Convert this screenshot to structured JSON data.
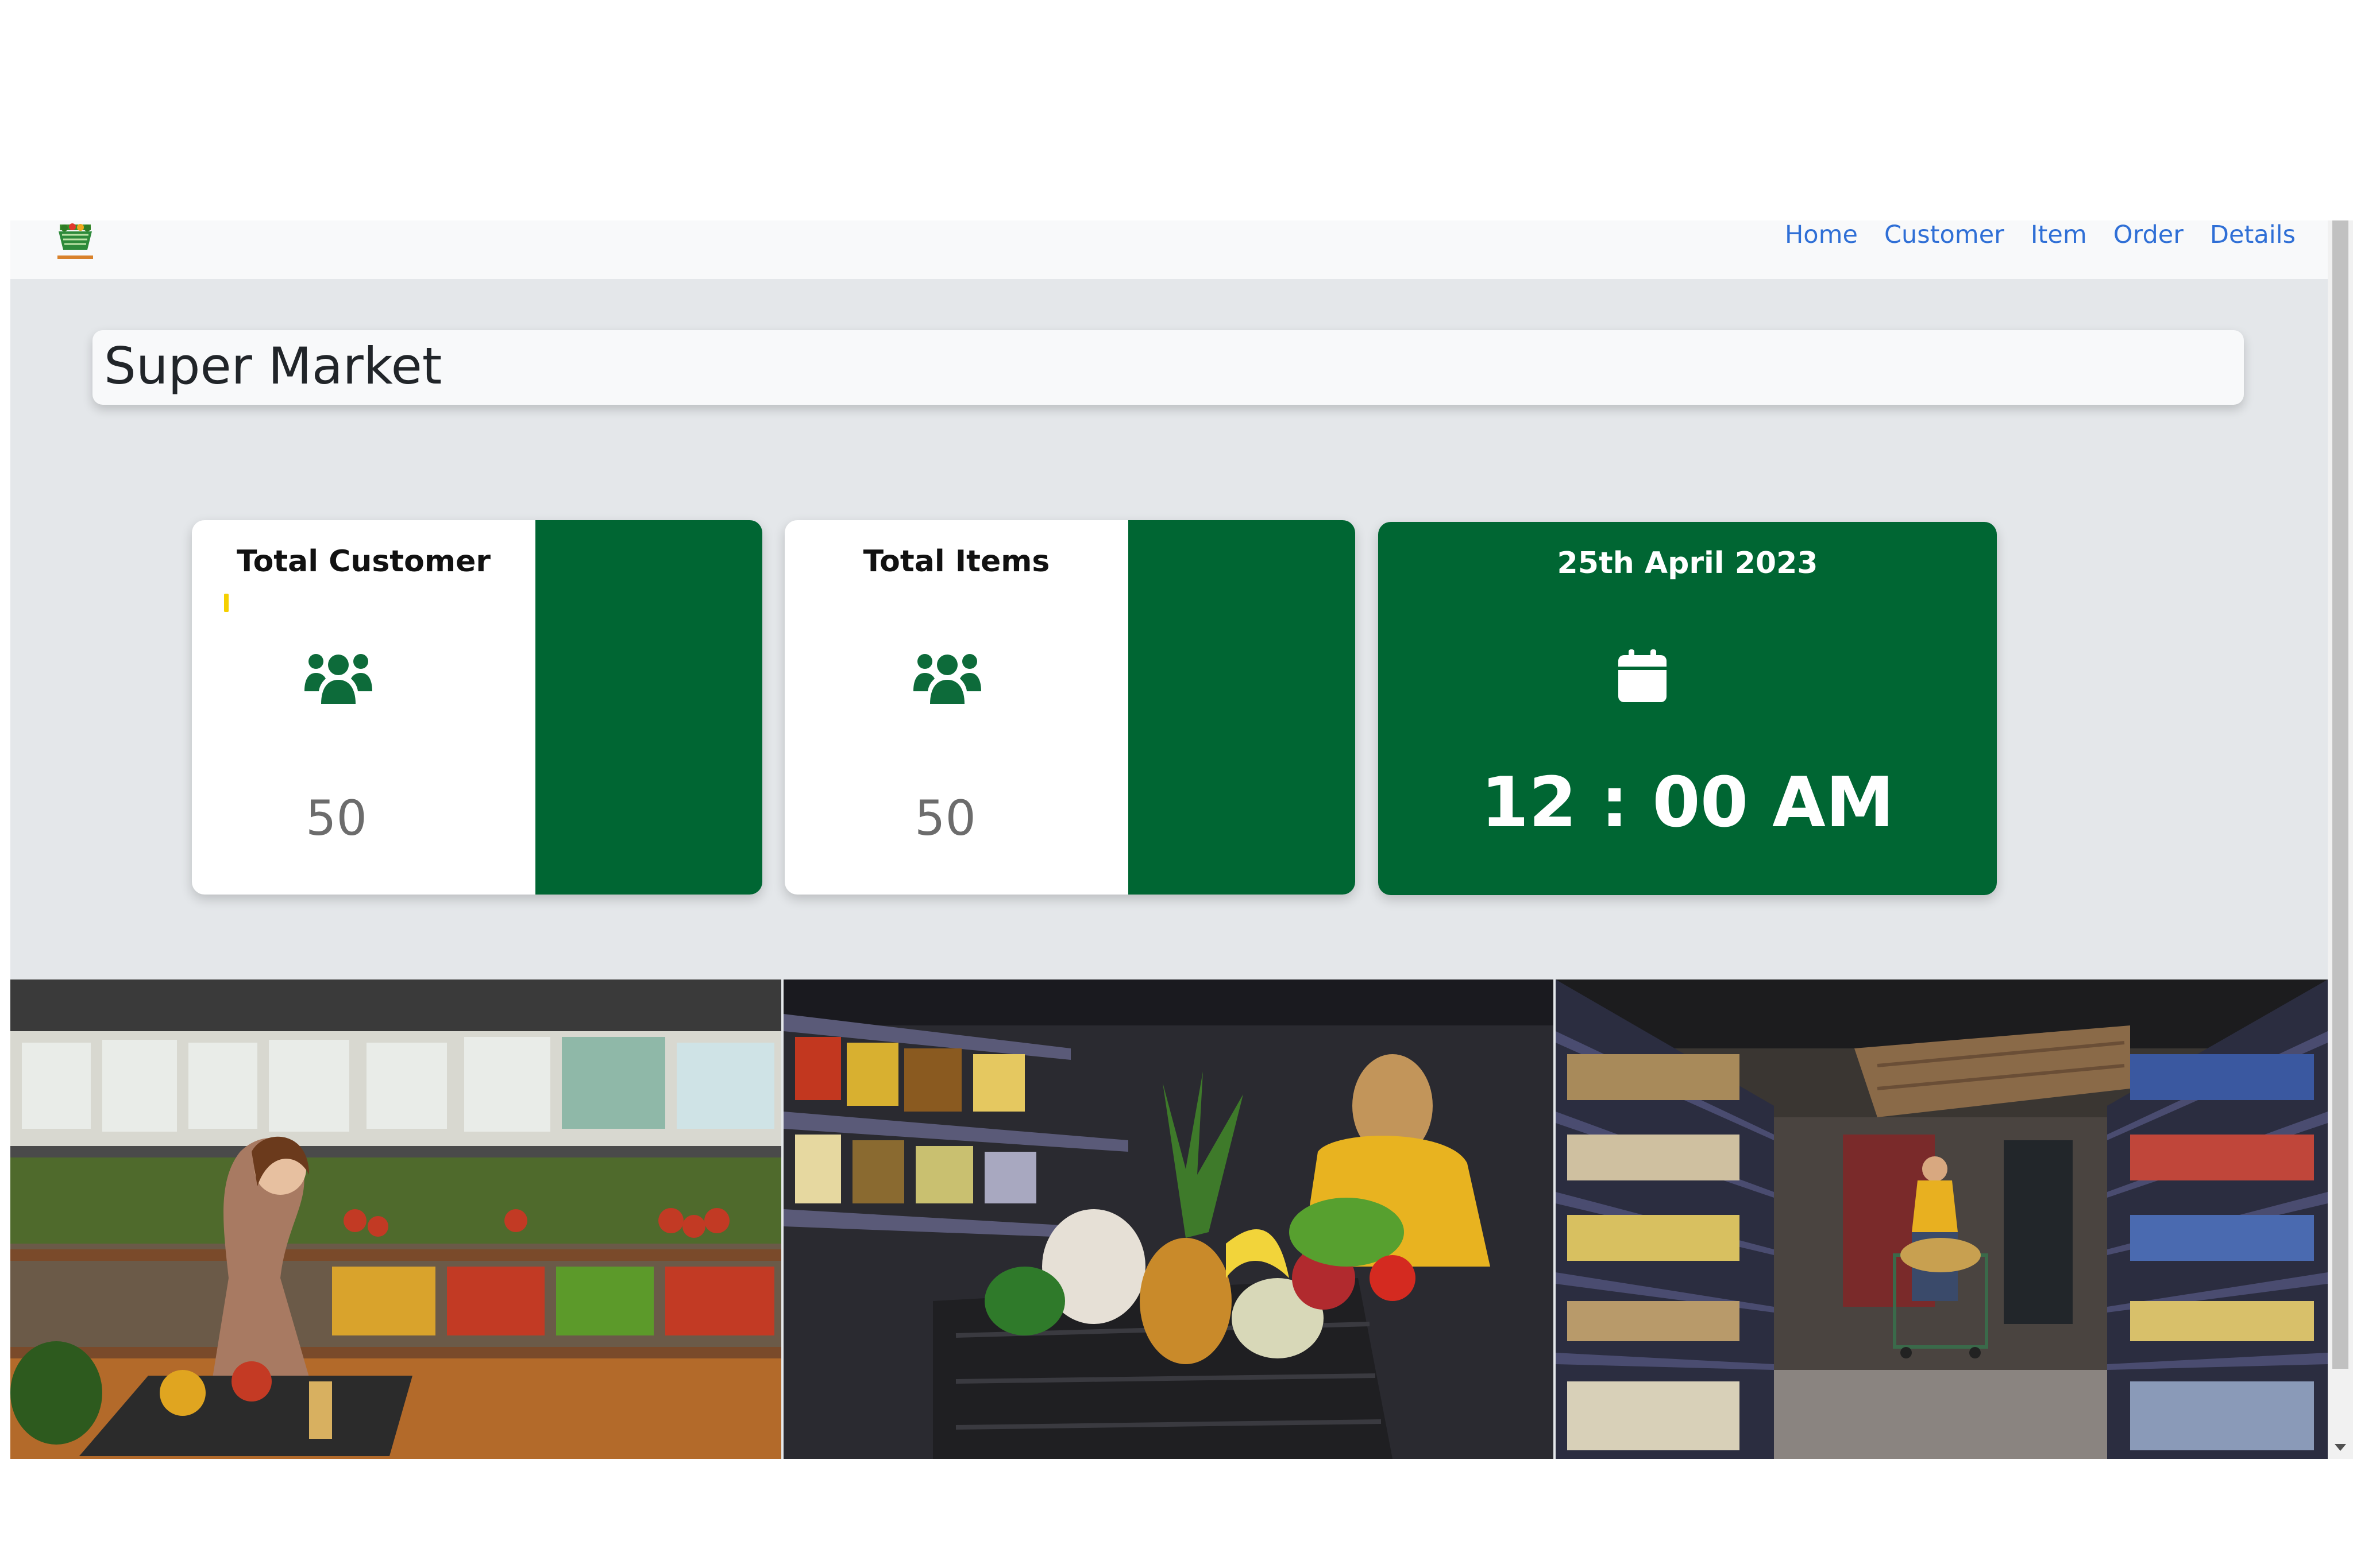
{
  "navbar": {
    "logo_icon": "supermarket-basket-logo",
    "links": [
      {
        "label": "Home"
      },
      {
        "label": "Customer"
      },
      {
        "label": "Item"
      },
      {
        "label": "Order"
      },
      {
        "label": "Details"
      }
    ]
  },
  "header": {
    "title": "Super Market"
  },
  "cards": {
    "customer": {
      "title": "Total Customer",
      "value": "50",
      "icon": "users-icon"
    },
    "items": {
      "title": "Total Items",
      "value": "50",
      "icon": "users-icon"
    },
    "datetime": {
      "date": "25th April 2023",
      "time": "12 : 00 AM",
      "icon": "calendar-icon"
    }
  },
  "gallery": [
    {
      "name": "woman-shopping-produce-photo"
    },
    {
      "name": "shopping-cart-fruits-photo"
    },
    {
      "name": "supermarket-aisle-photo"
    }
  ],
  "colors": {
    "brand_green": "#006633",
    "nav_link": "#2f6fd6",
    "page_bg": "#e4e7ea"
  }
}
